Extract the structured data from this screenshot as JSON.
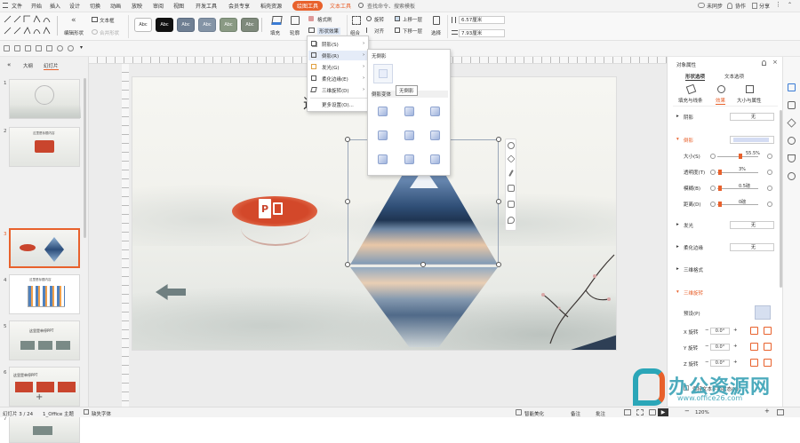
{
  "menubar": {
    "items": [
      "文件",
      "开始",
      "插入",
      "设计",
      "切换",
      "动画",
      "放映",
      "审阅",
      "视图",
      "开发工具",
      "会员专享",
      "稻壳资源"
    ],
    "active_tab": "绘图工具",
    "text_tool": "文本工具",
    "search": "查找命令、搜索模板",
    "sync": "未同步",
    "collab": "协作",
    "share": "分享"
  },
  "ribbon": {
    "textbox": "文本框",
    "edit_shape": "编辑形状",
    "merge_shape": "合并形状",
    "style_labels": [
      "Abc",
      "Abc",
      "Abc",
      "Abc",
      "Abc",
      "Abc"
    ],
    "fill": "填充",
    "outline": "轮廓",
    "format_painter": "格式刷",
    "shape_effects": "形状效果",
    "group": "组合",
    "rotate": "旋转",
    "align": "对齐",
    "bring_forward": "上移一层",
    "send_backward": "下移一层",
    "select": "选择",
    "height": "6.57厘米",
    "width": "7.93厘米"
  },
  "leftpanel": {
    "tab_outline": "大纲",
    "tab_slides": "幻灯片",
    "thumbs": [
      {
        "num": "1",
        "title": ""
      },
      {
        "num": "2",
        "title": "这里是标题内容"
      },
      {
        "num": "3",
        "title": ""
      },
      {
        "num": "4",
        "title": "这里是标题内容"
      },
      {
        "num": "5",
        "title": "这里是单停PPT"
      },
      {
        "num": "6",
        "title": "这里是单停PPT"
      },
      {
        "num": "7",
        "title": ""
      }
    ]
  },
  "effects_menu": {
    "items": [
      "阴影(S)",
      "倒影(R)",
      "发光(G)",
      "柔化边缘(E)",
      "三维旋转(D)",
      "更多设置(O)..."
    ]
  },
  "reflection_submenu": {
    "none_label": "无倒影",
    "variant_label": "倒影变体",
    "tooltip": "无倒影"
  },
  "slide": {
    "title_fragment": "这"
  },
  "rightpanel": {
    "title": "对象属性",
    "tab_shape": "形状选项",
    "tab_text": "文本选项",
    "subtab_fill": "填充与线条",
    "subtab_effect": "效果",
    "subtab_size": "大小与属性",
    "shadow": "阴影",
    "shadow_value": "无",
    "reflection": "倒影",
    "size": "大小(S)",
    "size_value": "55.5%",
    "transparency": "透明度(T)",
    "transparency_value": "3%",
    "blur": "模糊(B)",
    "blur_value": "0.5磅",
    "distance": "距离(D)",
    "distance_value": "0磅",
    "glow": "发光",
    "glow_value": "无",
    "soft_edge": "柔化边缘",
    "soft_edge_value": "无",
    "format_3d": "三维格式",
    "rotation_3d": "三维旋转",
    "preset": "预设(P)",
    "x_rot": "X 旋转",
    "y_rot": "Y 旋转",
    "z_rot": "Z 旋转",
    "rot_value": "0.0°",
    "keep_text_flat": "保持文本平面状态(K)"
  },
  "statusbar": {
    "slide_info": "幻灯片 3 / 24",
    "theme": "1_Office 主题",
    "missing_font": "缺失字体",
    "smart_beauty": "智能美化",
    "notes": "备注",
    "comments": "批注",
    "zoom": "120%"
  },
  "watermark": {
    "text": "办公资源网",
    "url": "www.office26.com"
  }
}
